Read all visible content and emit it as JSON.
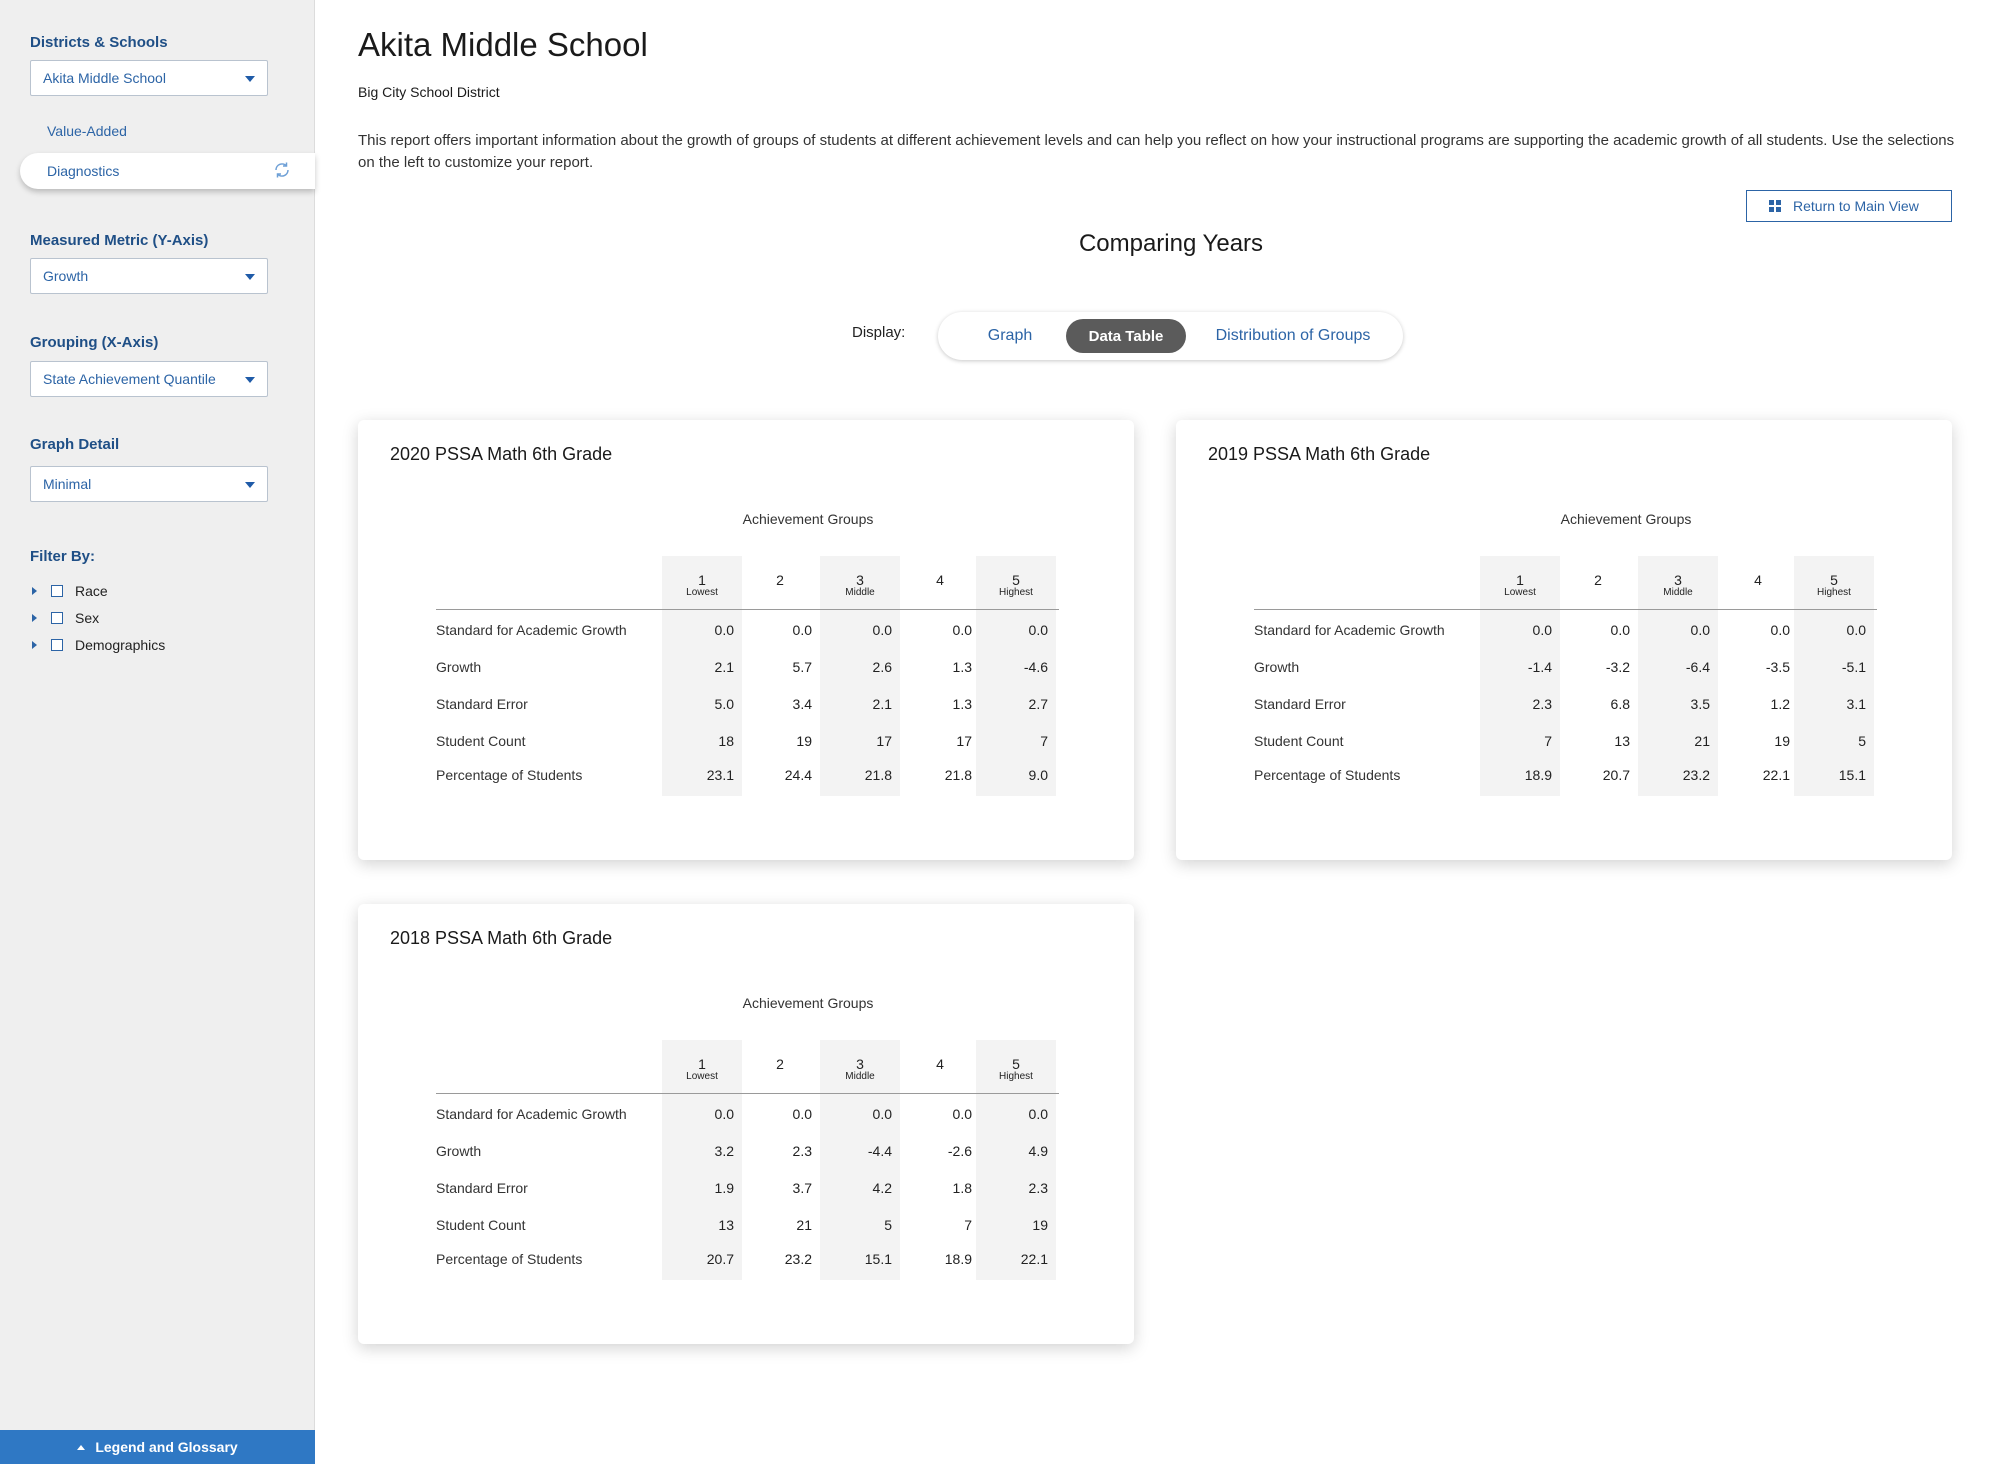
{
  "sidebar": {
    "districts_label": "Districts & Schools",
    "school_select": "Akita Middle School",
    "nav_value_added": "Value-Added",
    "nav_diagnostics": "Diagnostics",
    "metric_label": "Measured Metric (Y-Axis)",
    "metric_select": "Growth",
    "grouping_label": "Grouping (X-Axis)",
    "grouping_select": "State Achievement Quantile",
    "detail_label": "Graph Detail",
    "detail_select": "Minimal",
    "filter_label": "Filter By:",
    "filters": [
      "Race",
      "Sex",
      "Demographics"
    ],
    "legend_button": "Legend and Glossary"
  },
  "header": {
    "title": "Akita Middle School",
    "district": "Big City School District",
    "description": "This report offers important information about the growth of groups of students at different achievement levels and can help you reflect on how your instructional programs are supporting the academic growth of all students. Use the selections on the left to customize your report.",
    "return_button": "Return to Main View"
  },
  "section_title": "Comparing Years",
  "display": {
    "label": "Display:",
    "options": [
      "Graph",
      "Data Table",
      "Distribution of Groups"
    ],
    "selected": "Data Table"
  },
  "achievement_label": "Achievement Groups",
  "columns": [
    {
      "num": "1",
      "sub": "Lowest"
    },
    {
      "num": "2",
      "sub": ""
    },
    {
      "num": "3",
      "sub": "Middle"
    },
    {
      "num": "4",
      "sub": ""
    },
    {
      "num": "5",
      "sub": "Highest"
    }
  ],
  "row_labels": [
    "Standard for Academic Growth",
    "Growth",
    "Standard Error",
    "Student Count",
    "Percentage of Students"
  ],
  "tables": [
    {
      "title": "2020 PSSA Math 6th Grade",
      "rows": [
        [
          "0.0",
          "0.0",
          "0.0",
          "0.0",
          "0.0"
        ],
        [
          "2.1",
          "5.7",
          "2.6",
          "1.3",
          "-4.6"
        ],
        [
          "5.0",
          "3.4",
          "2.1",
          "1.3",
          "2.7"
        ],
        [
          "18",
          "19",
          "17",
          "17",
          "7"
        ],
        [
          "23.1",
          "24.4",
          "21.8",
          "21.8",
          "9.0"
        ]
      ]
    },
    {
      "title": "2019 PSSA Math 6th Grade",
      "rows": [
        [
          "0.0",
          "0.0",
          "0.0",
          "0.0",
          "0.0"
        ],
        [
          "-1.4",
          "-3.2",
          "-6.4",
          "-3.5",
          "-5.1"
        ],
        [
          "2.3",
          "6.8",
          "3.5",
          "1.2",
          "3.1"
        ],
        [
          "7",
          "13",
          "21",
          "19",
          "5"
        ],
        [
          "18.9",
          "20.7",
          "23.2",
          "22.1",
          "15.1"
        ]
      ]
    },
    {
      "title": "2018 PSSA Math 6th Grade",
      "rows": [
        [
          "0.0",
          "0.0",
          "0.0",
          "0.0",
          "0.0"
        ],
        [
          "3.2",
          "2.3",
          "-4.4",
          "-2.6",
          "4.9"
        ],
        [
          "1.9",
          "3.7",
          "4.2",
          "1.8",
          "2.3"
        ],
        [
          "13",
          "21",
          "5",
          "7",
          "19"
        ],
        [
          "20.7",
          "23.2",
          "15.1",
          "18.9",
          "22.1"
        ]
      ]
    }
  ],
  "colors": {
    "accent": "#2c64a6",
    "sidebar_bg": "#efefef",
    "legend_bar": "#2f78c4",
    "toggle_active": "#5b5b5b"
  },
  "icons": {
    "select_caret": "caret-down-icon",
    "refresh": "refresh-icon",
    "return": "grid-icon",
    "expand": "caret-right-icon",
    "legend": "caret-up-icon"
  }
}
